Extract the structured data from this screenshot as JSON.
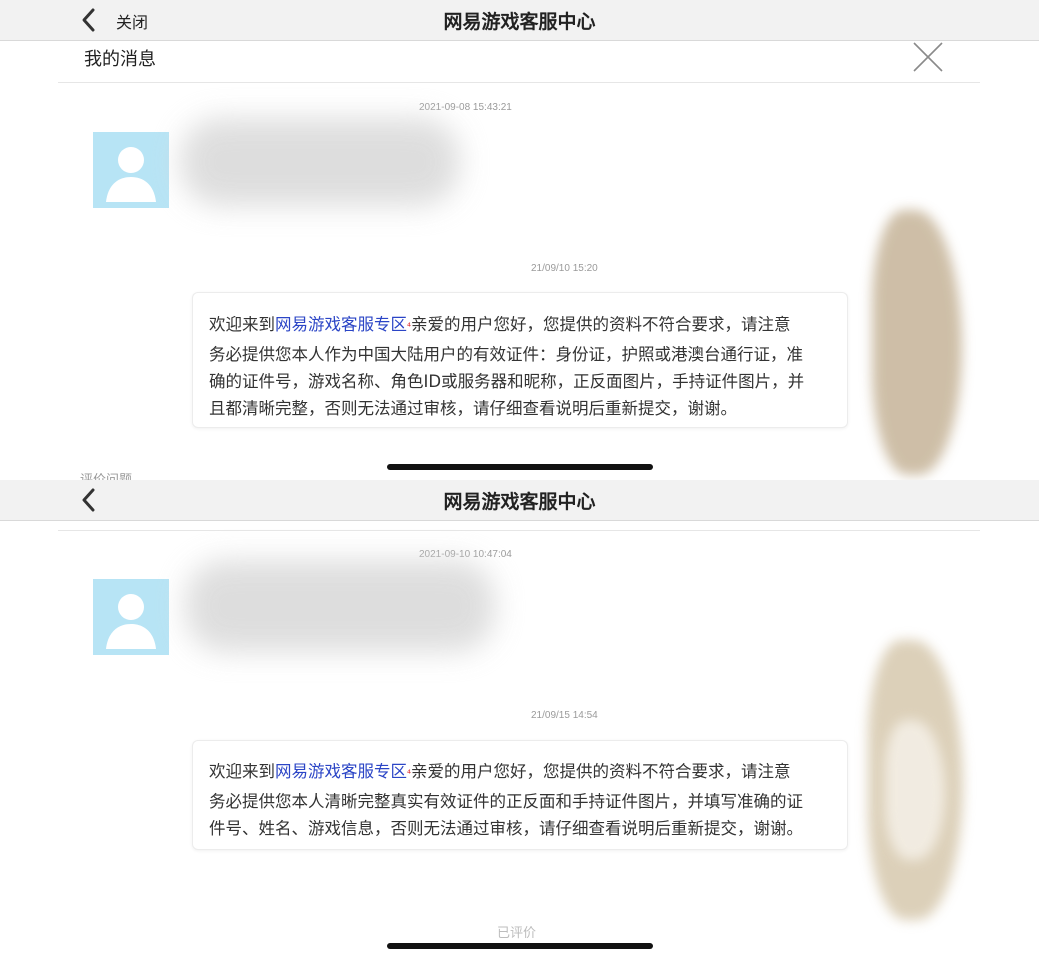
{
  "screen1": {
    "nav_title": "网易游戏客服中心",
    "close_label": "关闭",
    "section_title": "我的消息",
    "msg1_timestamp": "2021-09-08 15:43:21",
    "msg2_timestamp": "21/09/10 15:20",
    "reply_prefix": "欢迎来到",
    "reply_link": "网易游戏客服专区",
    "reply_mark": "⁴",
    "reply_lines": [
      "亲爱的用户您好，您提供的资料不符合要求，请注意",
      "务必提供您本人作为中国大陆用户的有效证件：身份证，护照或港澳台通行证，准",
      "确的证件号，游戏名称、角色ID或服务器和昵称，正反面图片，手持证件图片，并",
      "且都清晰完整，否则无法通过审核，请仔细查看说明后重新提交，谢谢。"
    ],
    "cutoff_text": "评价问题"
  },
  "screen2": {
    "nav_title": "网易游戏客服中心",
    "msg1_timestamp": "2021-09-10 10:47:04",
    "msg2_timestamp": "21/09/15 14:54",
    "reply_prefix": "欢迎来到",
    "reply_link": "网易游戏客服专区",
    "reply_mark": "⁴",
    "reply_lines": [
      "亲爱的用户您好，您提供的资料不符合要求，请注意",
      "务必提供您本人清晰完整真实有效证件的正反面和手持证件图片，并填写准确的证",
      "件号、姓名、游戏信息，否则无法通过审核，请仔细查看说明后重新提交，谢谢。"
    ],
    "rated_label": "已评价"
  },
  "colors": {
    "link": "#2b45c6",
    "avatar": "#b7e4f5",
    "navbar": "#f2f2f2"
  },
  "icons": [
    "back-chevron-icon",
    "close-x-icon",
    "default-avatar-icon"
  ]
}
